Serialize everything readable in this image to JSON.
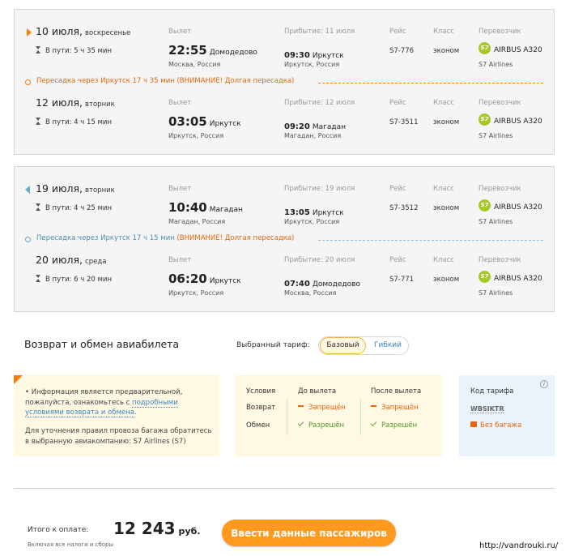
{
  "colors": {
    "accent": "#ff7a00",
    "return_accent": "#6aa9c8",
    "carrier": "#a6c928",
    "cta": "#ff9a1e"
  },
  "labels": {
    "departure": "Вылет",
    "arrival": "Прибытие:",
    "flight": "Рейс",
    "class": "Класс",
    "carrier": "Перевозчик",
    "in_transit": "В пути:"
  },
  "outbound": {
    "seg1": {
      "date": "10 июля,",
      "dow": "воскресенье",
      "duration": "5 ч 35 мин",
      "arrival_label": "Прибытие: 11 июля",
      "dep_time": "22:55",
      "dep_airport": "Домодедово",
      "dep_city": "Москва, Россия",
      "arr_time": "09:30",
      "arr_airport": "Иркутск",
      "arr_city": "Иркутск, Россия",
      "flight": "S7-776",
      "class": "эконом",
      "plane": "AIRBUS A320",
      "airline": "S7 Airlines"
    },
    "transfer": {
      "text": "Пересадка через Иркутск 17 ч 35 мин",
      "warning": "(ВНИМАНИЕ! Долгая пересадка)"
    },
    "seg2": {
      "date": "12 июля,",
      "dow": "вторник",
      "duration": "4 ч 15 мин",
      "arrival_label": "Прибытие: 12 июля",
      "dep_time": "03:05",
      "dep_airport": "Иркутск",
      "dep_city": "Иркутск, Россия",
      "arr_time": "09:20",
      "arr_airport": "Магадан",
      "arr_city": "Магадан, Россия",
      "flight": "S7-3511",
      "class": "эконом",
      "plane": "AIRBUS A320",
      "airline": "S7 Airlines"
    }
  },
  "return": {
    "seg1": {
      "date": "19 июля,",
      "dow": "вторник",
      "duration": "4 ч 25 мин",
      "arrival_label": "Прибытие: 19 июля",
      "dep_time": "10:40",
      "dep_airport": "Магадан",
      "dep_city": "Магадан, Россия",
      "arr_time": "13:05",
      "arr_airport": "Иркутск",
      "arr_city": "Иркутск, Россия",
      "flight": "S7-3512",
      "class": "эконом",
      "plane": "AIRBUS A320",
      "airline": "S7 Airlines"
    },
    "transfer": {
      "text": "Пересадка через Иркутск 17 ч 15 мин",
      "warning": "(ВНИМАНИЕ! Долгая пересадка)"
    },
    "seg2": {
      "date": "20 июля,",
      "dow": "среда",
      "duration": "6 ч 20 мин",
      "arrival_label": "Прибытие: 20 июля",
      "dep_time": "06:20",
      "dep_airport": "Иркутск",
      "dep_city": "Иркутск, Россия",
      "arr_time": "07:40",
      "arr_airport": "Домодедово",
      "arr_city": "Москва, Россия",
      "flight": "S7-771",
      "class": "эконом",
      "plane": "AIRBUS A320",
      "airline": "S7 Airlines"
    }
  },
  "carrier_logo": "S7",
  "refund": {
    "title": "Возврат и обмен авиабилета",
    "tariff_label": "Выбранный тариф:",
    "tariff_active": "Базовый",
    "tariff_other": "Гибкий",
    "info_pre": "• Информация является предварительной, пожалуйста, ознакомьтесь с ",
    "info_link": "подробными условиями возврата и обмена",
    "info_post": ".",
    "baggage_pre": "Для уточнения правил провоза багажа обратитесь в выбранную авиакомпанию: ",
    "baggage_link": "S7 Airlines (S7)",
    "table": {
      "h_conditions": "Условия",
      "h_before": "До вылета",
      "h_after": "После вылета",
      "row_refund": "Возврат",
      "row_exchange": "Обмен",
      "forbidden": "Запрещён",
      "allowed": "Разрешён"
    },
    "fare_code_label": "Код тарифа",
    "fare_code": "WBSIKTR",
    "no_baggage": "Без багажа",
    "info_icon": "i"
  },
  "total": {
    "label": "Итого к оплате:",
    "amount": "12 243",
    "currency": "руб.",
    "note": "Включая все налоги и сборы",
    "cta": "Ввести данные пассажиров"
  },
  "watermark": "http://vandrouki.ru/"
}
